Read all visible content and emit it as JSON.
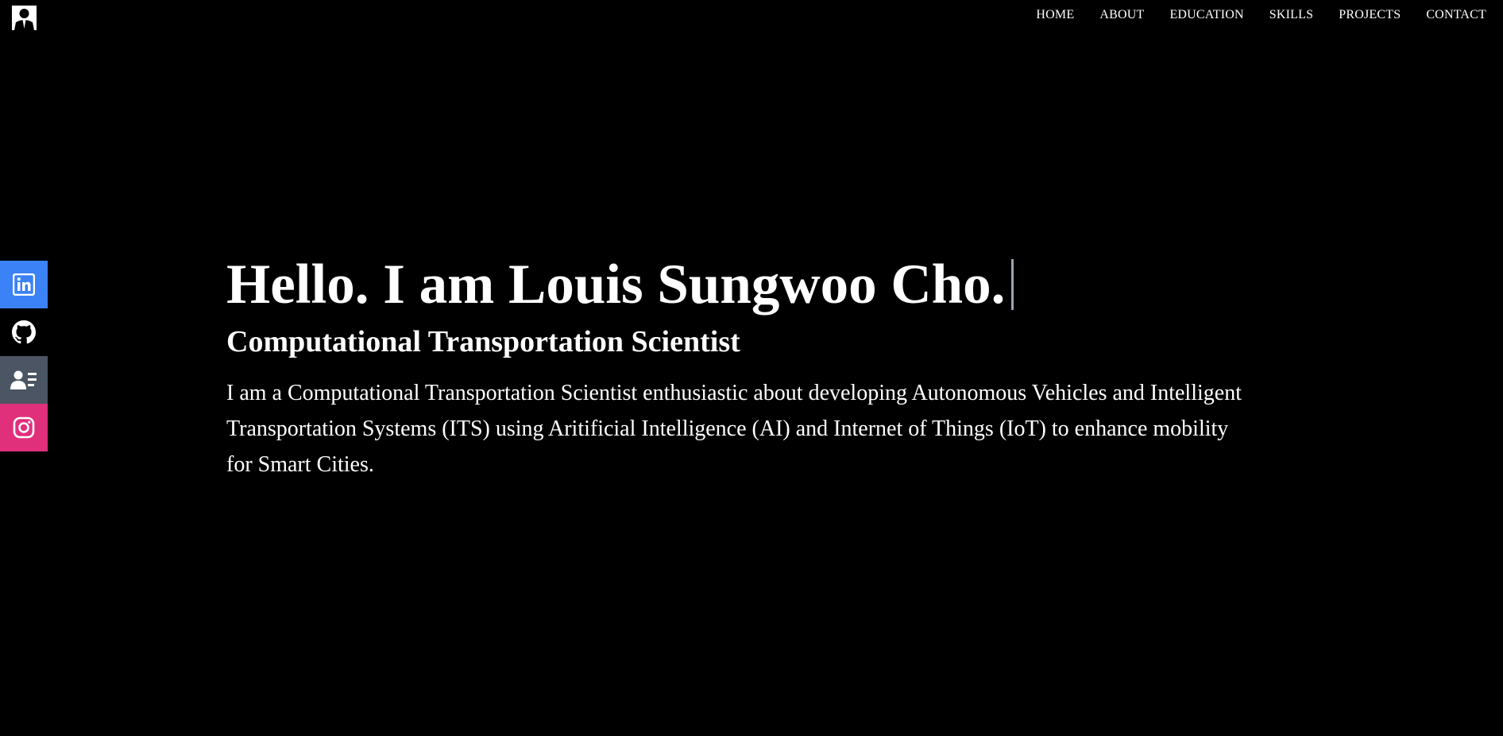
{
  "header": {
    "logo_icon": "person-silhouette-icon",
    "nav": [
      {
        "label": "HOME"
      },
      {
        "label": "ABOUT"
      },
      {
        "label": "EDUCATION"
      },
      {
        "label": "SKILLS"
      },
      {
        "label": "PROJECTS"
      },
      {
        "label": "CONTACT"
      }
    ]
  },
  "social": [
    {
      "icon": "linkedin-icon",
      "color": "#3b82f6"
    },
    {
      "icon": "github-icon",
      "color": "#000000"
    },
    {
      "icon": "resume-icon",
      "color": "#4b5563"
    },
    {
      "icon": "instagram-icon",
      "color": "#e0307c"
    }
  ],
  "hero": {
    "greeting": "Hello. I am Louis Sungwoo Cho.",
    "title": "Computational Transportation Scientist",
    "description": "I am a Computational Transportation Scientist enthusiastic about developing Autonomous Vehicles and Intelligent Transportation Systems (ITS) using Aritificial Intelligence (AI) and Internet of Things (IoT) to enhance mobility for Smart Cities."
  },
  "colors": {
    "background": "#000000",
    "text": "#ffffff",
    "cursor": "#9ca3af"
  }
}
